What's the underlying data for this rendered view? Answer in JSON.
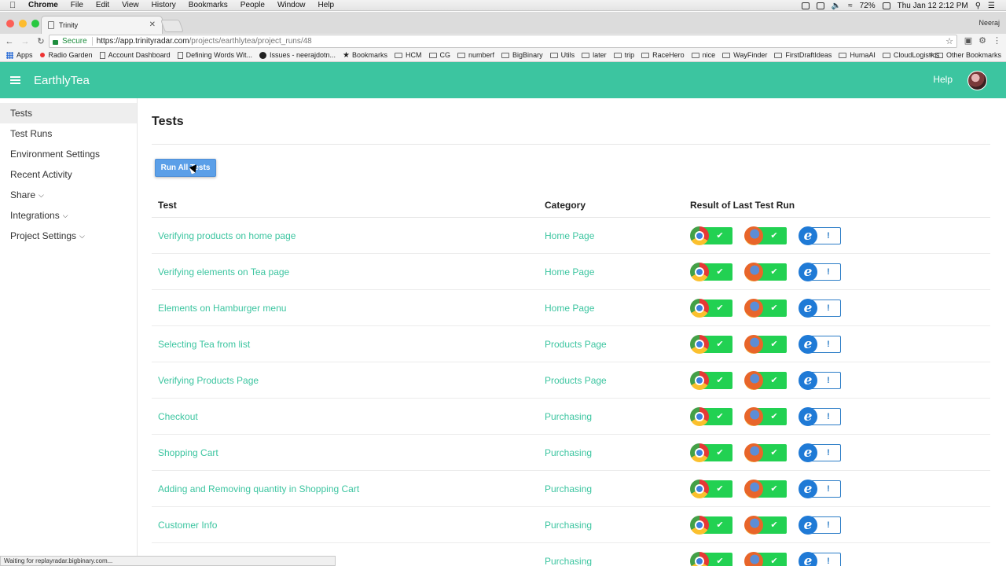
{
  "menubar": {
    "app": "Chrome",
    "items": [
      "File",
      "Edit",
      "View",
      "History",
      "Bookmarks",
      "People",
      "Window",
      "Help"
    ],
    "battery": "72%",
    "datetime": "Thu Jan 12  2:12 PM"
  },
  "browser": {
    "tab_title": "Trinity",
    "profile": "Neeraj",
    "secure_label": "Secure",
    "url_host": "https://app.trinityradar.com",
    "url_path": "/projects/earthlytea/project_runs/48",
    "bookmarks": [
      "Apps",
      "Radio Garden",
      "Account Dashboard",
      "Defining Words Wit...",
      "Issues - neerajdotn...",
      "Bookmarks",
      "HCM",
      "CG",
      "numberf",
      "BigBinary",
      "Utils",
      "later",
      "trip",
      "RaceHero",
      "nice",
      "WayFinder",
      "FirstDraftIdeas",
      "HumaAI",
      "CloudLogistics"
    ],
    "other_bookmarks": "Other Bookmarks",
    "status": "Waiting for replayradar.bigbinary.com..."
  },
  "app": {
    "brand": "EarthlyTea",
    "help": "Help",
    "accent": "#3cc5a0"
  },
  "sidebar": {
    "items": [
      {
        "label": "Tests"
      },
      {
        "label": "Test Runs"
      },
      {
        "label": "Environment Settings"
      },
      {
        "label": "Recent Activity"
      },
      {
        "label": "Share"
      },
      {
        "label": "Integrations"
      },
      {
        "label": "Project Settings"
      }
    ]
  },
  "main": {
    "title": "Tests",
    "run_button": "Run All Tests",
    "columns": {
      "test": "Test",
      "category": "Category",
      "result": "Result of Last Test Run"
    },
    "rows": [
      {
        "test": "Verifying products on home page",
        "category": "Home Page"
      },
      {
        "test": "Verifying elements on Tea page",
        "category": "Home Page"
      },
      {
        "test": "Elements on Hamburger menu",
        "category": "Home Page"
      },
      {
        "test": "Selecting Tea from list",
        "category": "Products Page"
      },
      {
        "test": "Verifying Products Page",
        "category": "Products Page"
      },
      {
        "test": "Checkout",
        "category": "Purchasing"
      },
      {
        "test": "Shopping Cart",
        "category": "Purchasing"
      },
      {
        "test": "Adding and Removing quantity in Shopping Cart",
        "category": "Purchasing"
      },
      {
        "test": "Customer Info",
        "category": "Purchasing"
      },
      {
        "test": "",
        "category": "Purchasing"
      }
    ],
    "result_symbols": {
      "pass": "✔",
      "warn": "!"
    },
    "result_colors": {
      "pass": "#22d152",
      "warn": "#2c7dc7"
    }
  }
}
